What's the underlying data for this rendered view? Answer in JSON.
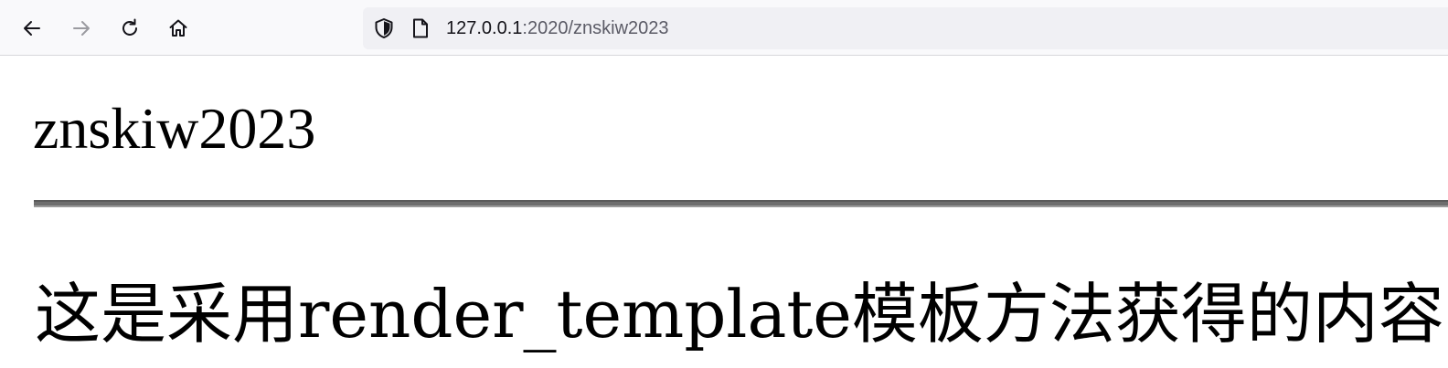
{
  "browser": {
    "url_host": "127.0.0.1",
    "url_path": ":2020/znskiw2023",
    "icons": {
      "back": "back-arrow-icon",
      "forward": "forward-arrow-icon",
      "reload": "reload-icon",
      "home": "home-icon",
      "tracking": "shield-icon",
      "page": "page-icon"
    },
    "colors": {
      "toolbar": "#f9f9fb",
      "urlbar": "#f0f0f4",
      "url_host": "#15141a",
      "url_path": "#5b5b66",
      "icon": "#15141a",
      "icon_disabled": "#9b9ba0"
    }
  },
  "page": {
    "heading": "znskiw2023",
    "paragraph": "这是采用render_template模板方法获得的内容:"
  }
}
